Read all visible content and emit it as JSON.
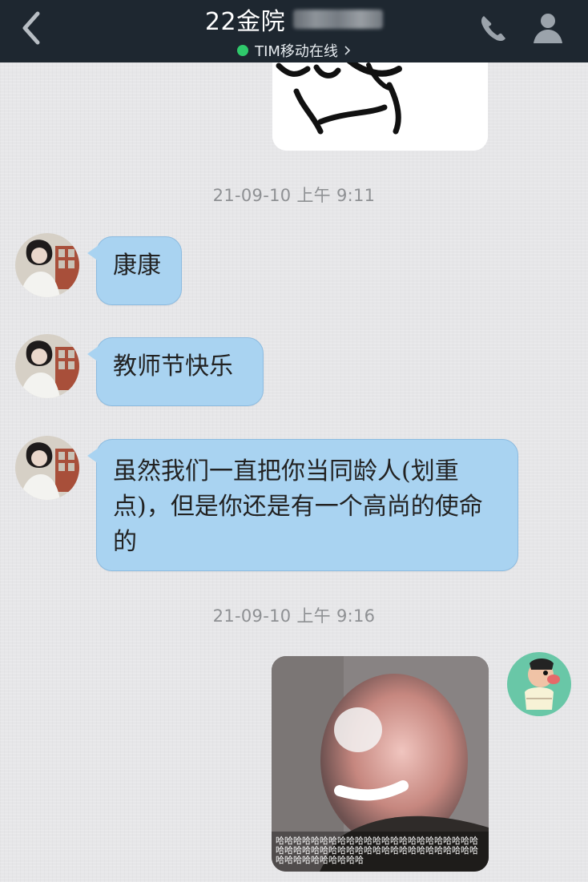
{
  "header": {
    "title": "22金院",
    "status_text": "TIM移动在线"
  },
  "messages": [
    {
      "type": "timestamp",
      "text": "21-09-10 上午 9:11"
    },
    {
      "type": "text",
      "sender": "other",
      "text": "康康"
    },
    {
      "type": "text",
      "sender": "other",
      "text": "教师节快乐"
    },
    {
      "type": "text",
      "sender": "other",
      "text": "虽然我们一直把你当同龄人(划重点)，但是你还是有一个高尚的使命的"
    },
    {
      "type": "timestamp",
      "text": "21-09-10 上午 9:16"
    },
    {
      "type": "image",
      "sender": "self",
      "caption": "哈哈哈哈哈哈哈哈哈哈哈哈哈哈哈哈哈哈哈哈哈哈哈哈哈哈哈哈哈哈哈哈哈哈哈哈哈哈哈哈哈哈哈哈哈哈哈哈哈哈哈哈哈哈哈哈"
    }
  ],
  "icons": {
    "back": "chevron-left-icon",
    "call": "phone-icon",
    "profile": "person-icon",
    "online": "online-status-dot"
  },
  "colors": {
    "topbar": "#1e2730",
    "online": "#2fc96b",
    "bubble": "#a9d3f1",
    "background": "#e6e6e8"
  }
}
